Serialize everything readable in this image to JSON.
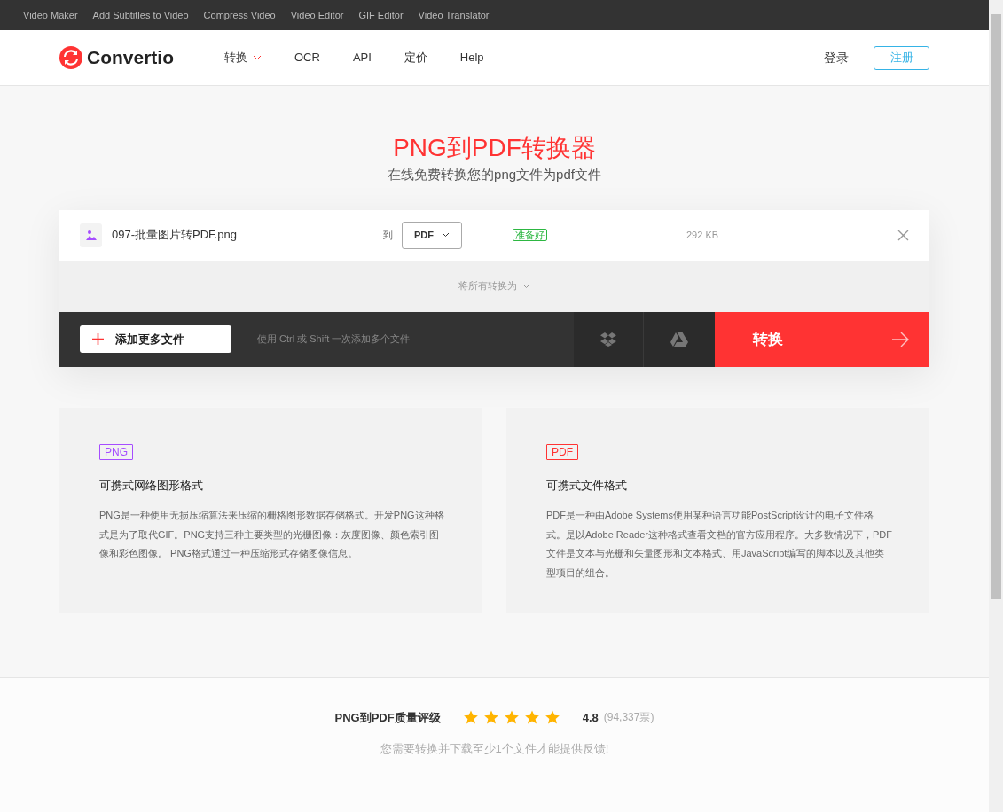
{
  "top_links": [
    "Video Maker",
    "Add Subtitles to Video",
    "Compress Video",
    "Video Editor",
    "GIF Editor",
    "Video Translator"
  ],
  "nav": {
    "logo": "Convertio",
    "items": [
      {
        "label": "转换",
        "dropdown": true
      },
      {
        "label": "OCR",
        "dropdown": false
      },
      {
        "label": "API",
        "dropdown": false
      },
      {
        "label": "定价",
        "dropdown": false
      },
      {
        "label": "Help",
        "dropdown": false
      }
    ],
    "login": "登录",
    "signup": "注册"
  },
  "hero": {
    "title": "PNG到PDF转换器",
    "subtitle": "在线免费转换您的png文件为pdf文件"
  },
  "file": {
    "name": "097-批量图片转PDF.png",
    "to": "到",
    "format": "PDF",
    "status": "准备好",
    "size": "292 KB"
  },
  "convert_all": "将所有转换为",
  "toolbar": {
    "add_button": "添加更多文件",
    "hint": "使用 Ctrl 或 Shift 一次添加多个文件",
    "convert_button": "转换"
  },
  "formats": [
    {
      "tag": "PNG",
      "color": "#a64dff",
      "title": "可携式网络图形格式",
      "text": "PNG是一种使用无损压缩算法来压缩的栅格图形数据存储格式。开发PNG这种格式是为了取代GIF。PNG支持三种主要类型的光栅图像：灰度图像、颜色索引图像和彩色图像。 PNG格式通过一种压缩形式存储图像信息。"
    },
    {
      "tag": "PDF",
      "color": "#ff3333",
      "title": "可携式文件格式",
      "text": "PDF是一种由Adobe Systems使用某种语言功能PostScript设计的电子文件格式。是以Adobe Reader这种格式查看文档的官方应用程序。大多数情况下，PDF文件是文本与光栅和矢量图形和文本格式、用JavaScript编写的脚本以及其他类型项目的组合。"
    }
  ],
  "rating": {
    "label": "PNG到PDF质量评级",
    "stars": 5,
    "score": "4.8",
    "votes": "(94,337票)",
    "note": "您需要转换并下载至少1个文件才能提供反馈!"
  }
}
